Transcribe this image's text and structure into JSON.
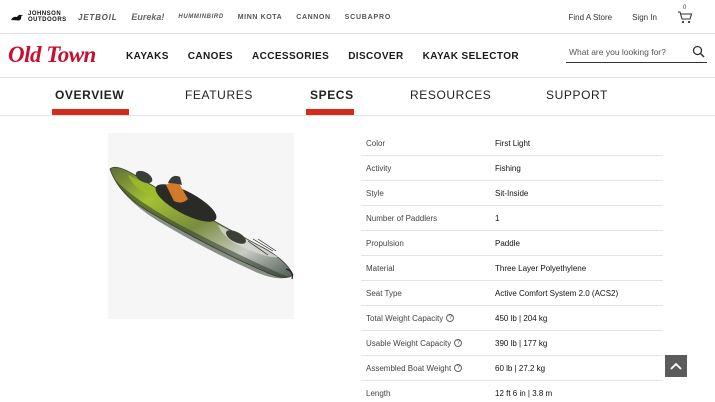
{
  "brands": {
    "johnson": "JOHNSON OUTDOORS",
    "jetboil": "JETBOIL",
    "eureka": "Eureka!",
    "humminbird": "HUMMINBIRD",
    "minnkota": "MINN KOTA",
    "cannon": "CANNON",
    "scubapro": "SCUBAPRO"
  },
  "utility": {
    "find_store": "Find A Store",
    "sign_in": "Sign In",
    "cart_count": "0"
  },
  "logo": {
    "text": "Old Town"
  },
  "nav": {
    "items": [
      "KAYAKS",
      "CANOES",
      "ACCESSORIES",
      "DISCOVER",
      "KAYAK SELECTOR"
    ]
  },
  "search": {
    "placeholder": "What are you looking for?"
  },
  "tabs": {
    "items": [
      "OVERVIEW",
      "FEATURES",
      "SPECS",
      "RESOURCES",
      "SUPPORT"
    ],
    "active": [
      "OVERVIEW",
      "SPECS"
    ]
  },
  "specs": {
    "rows": [
      {
        "label": "Color",
        "value": "First Light",
        "help": false
      },
      {
        "label": "Activity",
        "value": "Fishing",
        "help": false
      },
      {
        "label": "Style",
        "value": "Sit-Inside",
        "help": false
      },
      {
        "label": "Number of Paddlers",
        "value": "1",
        "help": false
      },
      {
        "label": "Propulsion",
        "value": "Paddle",
        "help": false
      },
      {
        "label": "Material",
        "value": "Three Layer Polyethylene",
        "help": false
      },
      {
        "label": "Seat Type",
        "value": "Active Comfort System 2.0 (ACS2)",
        "help": false
      },
      {
        "label": "Total Weight Capacity",
        "value": "450 lb | 204 kg",
        "help": true
      },
      {
        "label": "Usable Weight Capacity",
        "value": "390 lb | 177 kg",
        "help": true
      },
      {
        "label": "Assembled Boat Weight",
        "value": "60 lb | 27.2 kg",
        "help": true
      },
      {
        "label": "Length",
        "value": "12 ft 6 in | 3.8 m",
        "help": false
      }
    ],
    "help_glyph": "?"
  },
  "colors": {
    "accent_red": "#d52b1e",
    "logo_red": "#c8102e",
    "kayak_green": "#8fb32a",
    "back_to_top": "#5c5c5c"
  },
  "icons": {
    "cart": "cart-icon",
    "search": "search-icon",
    "back_to_top": "chevron-up-icon"
  }
}
